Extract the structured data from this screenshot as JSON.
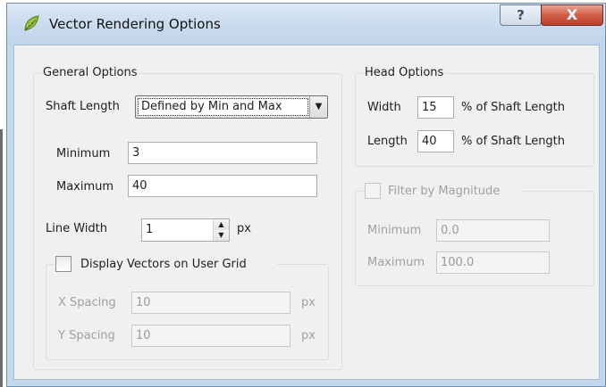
{
  "window": {
    "title": "Vector Rendering Options",
    "help_label": "?",
    "close_label": "X"
  },
  "general": {
    "legend": "General Options",
    "shaft_length_label": "Shaft Length",
    "shaft_length_value": "Defined by Min and Max",
    "minimum_label": "Minimum",
    "minimum_value": "3",
    "maximum_label": "Maximum",
    "maximum_value": "40",
    "line_width_label": "Line Width",
    "line_width_value": "1",
    "line_width_unit": "px"
  },
  "user_grid": {
    "label": "Display Vectors on User Grid",
    "checked": false,
    "x_spacing_label": "X Spacing",
    "x_spacing_value": "10",
    "x_unit": "px",
    "y_spacing_label": "Y Spacing",
    "y_spacing_value": "10",
    "y_unit": "px"
  },
  "head": {
    "legend": "Head Options",
    "width_label": "Width",
    "width_value": "15",
    "width_suffix": "% of Shaft Length",
    "length_label": "Length",
    "length_value": "40",
    "length_suffix": "% of Shaft Length"
  },
  "filter": {
    "label": "Filter by Magnitude",
    "checked": false,
    "minimum_label": "Minimum",
    "minimum_value": "0.0",
    "maximum_label": "Maximum",
    "maximum_value": "100.0"
  }
}
